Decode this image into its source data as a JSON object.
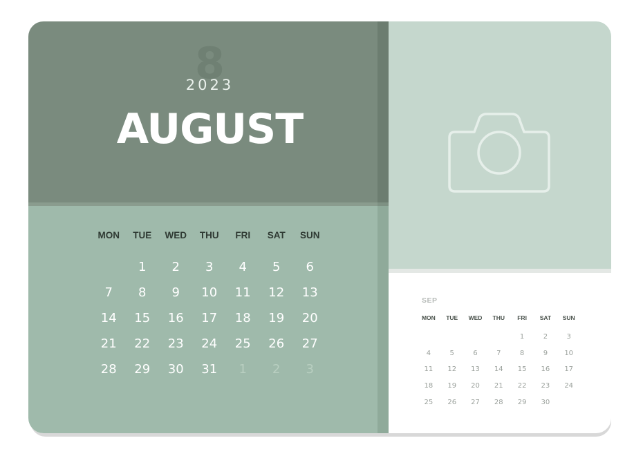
{
  "main": {
    "number": "8",
    "year": "2023",
    "month": "AUGUST",
    "weekdays": [
      "MON",
      "TUE",
      "WED",
      "THU",
      "FRI",
      "SAT",
      "SUN"
    ],
    "weeks": [
      [
        "",
        "1",
        "2",
        "3",
        "4",
        "5",
        "6"
      ],
      [
        "7",
        "8",
        "9",
        "10",
        "11",
        "12",
        "13"
      ],
      [
        "14",
        "15",
        "16",
        "17",
        "18",
        "19",
        "20"
      ],
      [
        "21",
        "22",
        "23",
        "24",
        "25",
        "26",
        "27"
      ],
      [
        "28",
        "29",
        "30",
        "31",
        "1",
        "2",
        "3"
      ]
    ]
  },
  "photo": {
    "icon": "camera-icon"
  },
  "next": {
    "month": "SEP",
    "weekdays": [
      "MON",
      "TUE",
      "WED",
      "THU",
      "FRI",
      "SAT",
      "SUN"
    ],
    "weeks": [
      [
        "",
        "",
        "",
        "",
        "1",
        "2",
        "3"
      ],
      [
        "4",
        "5",
        "6",
        "7",
        "8",
        "9",
        "10"
      ],
      [
        "11",
        "12",
        "13",
        "14",
        "15",
        "16",
        "17"
      ],
      [
        "18",
        "19",
        "20",
        "21",
        "22",
        "23",
        "24"
      ],
      [
        "25",
        "26",
        "27",
        "28",
        "29",
        "30",
        ""
      ]
    ]
  },
  "colors": {
    "header": "#7a8b7e",
    "grid_bg": "#9fbaab",
    "photo_bg": "#c5d7cd",
    "photo_icon": "#e6efea"
  }
}
